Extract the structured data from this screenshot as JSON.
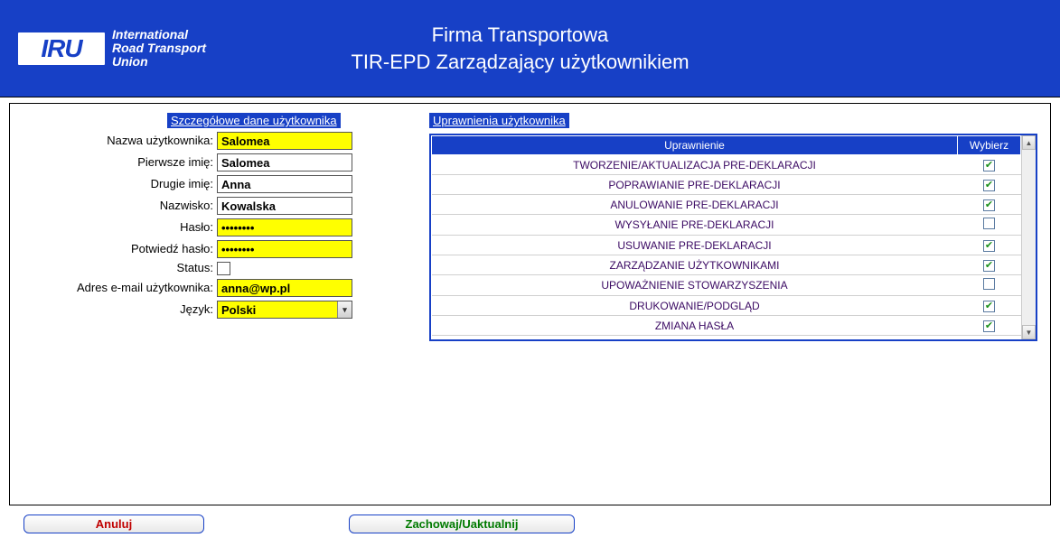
{
  "banner": {
    "logo_text": "IRU",
    "logo_tag_line1": "International",
    "logo_tag_line2": "Road Transport",
    "logo_tag_line3": "Union",
    "title1": "Firma Transportowa",
    "title2": "TIR-EPD Zarządzający użytkownikiem"
  },
  "left": {
    "section_title": "Szczegółowe dane użytkownika",
    "fields": {
      "username_label": "Nazwa użytkownika:",
      "username_value": "Salomea",
      "firstname_label": "Pierwsze imię:",
      "firstname_value": "Salomea",
      "middlename_label": "Drugie imię:",
      "middlename_value": "Anna",
      "lastname_label": "Nazwisko:",
      "lastname_value": "Kowalska",
      "password_label": "Hasło:",
      "password_value": "••••••••",
      "confirm_label": "Potwiedź hasło:",
      "confirm_value": "••••••••",
      "status_label": "Status:",
      "email_label": "Adres e-mail użytkownika:",
      "email_value": "anna@wp.pl",
      "language_label": "Język:",
      "language_value": "Polski"
    }
  },
  "right": {
    "section_title": "Uprawnienia użytkownika",
    "header_permission": "Uprawnienie",
    "header_select": "Wybierz",
    "rows": [
      {
        "name": "TWORZENIE/AKTUALIZACJA PRE-DEKLARACJI",
        "checked": true
      },
      {
        "name": "POPRAWIANIE PRE-DEKLARACJI",
        "checked": true
      },
      {
        "name": "ANULOWANIE PRE-DEKLARACJI",
        "checked": true
      },
      {
        "name": "WYSYŁANIE PRE-DEKLARACJI",
        "checked": false
      },
      {
        "name": "USUWANIE PRE-DEKLARACJI",
        "checked": true
      },
      {
        "name": "ZARZĄDZANIE UŻYTKOWNIKAMI",
        "checked": true
      },
      {
        "name": "UPOWAŻNIENIE STOWARZYSZENIA",
        "checked": false
      },
      {
        "name": "DRUKOWANIE/PODGLĄD",
        "checked": true
      },
      {
        "name": "ZMIANA HASŁA",
        "checked": true
      }
    ]
  },
  "buttons": {
    "cancel": "Anuluj",
    "save": "Zachowaj/Uaktualnij"
  }
}
